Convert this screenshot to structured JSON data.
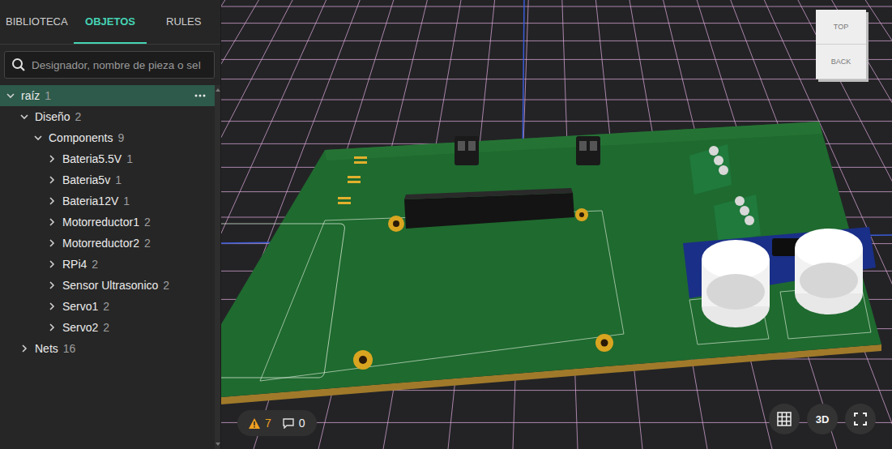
{
  "tabs": [
    {
      "label": "BIBLIOTECA",
      "selected": false
    },
    {
      "label": "OBJETOS",
      "selected": true
    },
    {
      "label": "RULES",
      "selected": false
    }
  ],
  "search": {
    "placeholder": "Designador, nombre de pieza o sel"
  },
  "tree": [
    {
      "label": "raíz",
      "count": "1",
      "level": 0,
      "expanded": true,
      "selected": true
    },
    {
      "label": "Diseño",
      "count": "2",
      "level": 1,
      "expanded": true,
      "selected": false
    },
    {
      "label": "Components",
      "count": "9",
      "level": 2,
      "expanded": true,
      "selected": false
    },
    {
      "label": "Bateria5.5V",
      "count": "1",
      "level": 3,
      "expanded": false,
      "selected": false
    },
    {
      "label": "Bateria5v",
      "count": "1",
      "level": 3,
      "expanded": false,
      "selected": false
    },
    {
      "label": "Bateria12V",
      "count": "1",
      "level": 3,
      "expanded": false,
      "selected": false
    },
    {
      "label": "Motorreductor1",
      "count": "2",
      "level": 3,
      "expanded": false,
      "selected": false
    },
    {
      "label": "Motorreductor2",
      "count": "2",
      "level": 3,
      "expanded": false,
      "selected": false
    },
    {
      "label": "RPi4",
      "count": "2",
      "level": 3,
      "expanded": false,
      "selected": false
    },
    {
      "label": "Sensor Ultrasonico",
      "count": "2",
      "level": 3,
      "expanded": false,
      "selected": false
    },
    {
      "label": "Servo1",
      "count": "2",
      "level": 3,
      "expanded": false,
      "selected": false
    },
    {
      "label": "Servo2",
      "count": "2",
      "level": 3,
      "expanded": false,
      "selected": false
    },
    {
      "label": "Nets",
      "count": "16",
      "level": 1,
      "expanded": false,
      "selected": false
    }
  ],
  "view_cube": {
    "faces": [
      "TOP",
      "BACK"
    ]
  },
  "status": {
    "warnings": "7",
    "comments": "0"
  },
  "view_buttons": [
    {
      "kind": "grid",
      "label": ""
    },
    {
      "kind": "text",
      "label": "3D"
    },
    {
      "kind": "fullscreen",
      "label": ""
    }
  ]
}
